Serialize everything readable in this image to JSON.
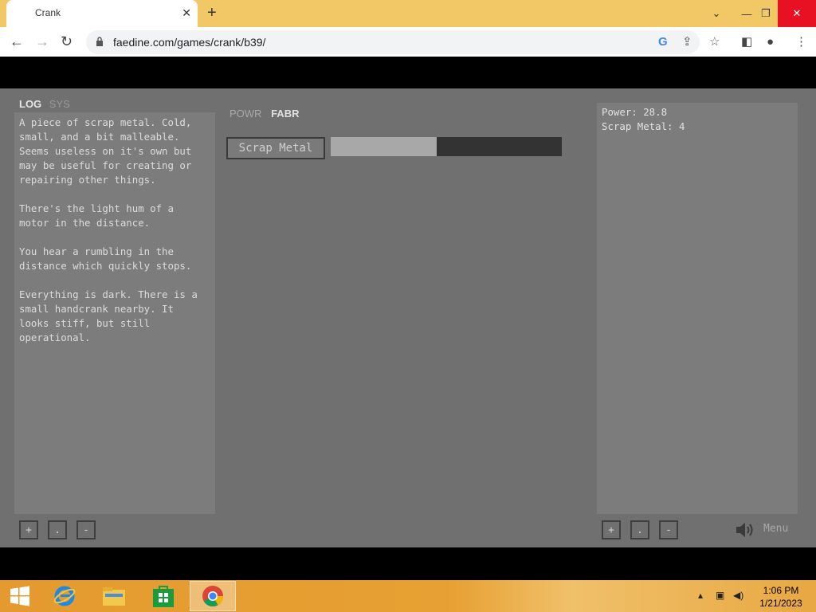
{
  "browser": {
    "tab_title": "Crank",
    "url": "faedine.com/games/crank/b39/"
  },
  "game": {
    "left_tabs": [
      "LOG",
      "SYS"
    ],
    "log_text": "A piece of scrap metal. Cold,\nsmall, and a bit malleable.\nSeems useless on it's own but\nmay be useful for creating or\nrepairing other things.\n\nThere's the light hum of a\nmotor in the distance.\n\nYou hear a rumbling in the\ndistance which quickly stops.\n\nEverything is dark. There is a\nsmall handcrank nearby. It\nlooks stiff, but still\noperational.",
    "mid_tabs": [
      "POWR",
      "FABR"
    ],
    "scrap_button": "Scrap Metal",
    "scrap_progress": 0.46,
    "stats": [
      "Power: 28.8",
      "Scrap Metal: 4"
    ],
    "buttons": {
      "plus": "+",
      "dot": ".",
      "minus": "-"
    },
    "menu_label": "Menu",
    "colors": {
      "background": "#707070",
      "panel": "#7c7c7c",
      "text": "#dcdcdc"
    }
  },
  "taskbar": {
    "time": "1:06 PM",
    "date": "1/21/2023"
  }
}
